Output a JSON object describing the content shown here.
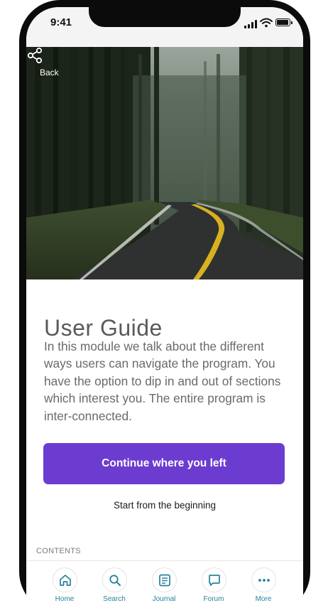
{
  "status_bar": {
    "time": "9:41"
  },
  "hero": {
    "back_label": "Back",
    "share_icon": "share-icon"
  },
  "guide": {
    "title": "User Guide",
    "description": "In this module we talk about the different ways users can navigate the program. You have the option to dip in and out of sections which interest you. The entire program is inter-connected.",
    "continue_label": "Continue where you left",
    "restart_label": "Start from the beginning",
    "contents_heading": "CONTENTS"
  },
  "tab_bar": {
    "items": [
      {
        "label": "Home",
        "icon": "home-icon"
      },
      {
        "label": "Search",
        "icon": "search-icon"
      },
      {
        "label": "Journal",
        "icon": "journal-icon"
      },
      {
        "label": "Forum",
        "icon": "forum-icon"
      },
      {
        "label": "More",
        "icon": "more-icon"
      }
    ]
  },
  "colors": {
    "accent": "#6c3cd0",
    "tab_label": "#27829a",
    "title_text": "#5a5a5a"
  }
}
